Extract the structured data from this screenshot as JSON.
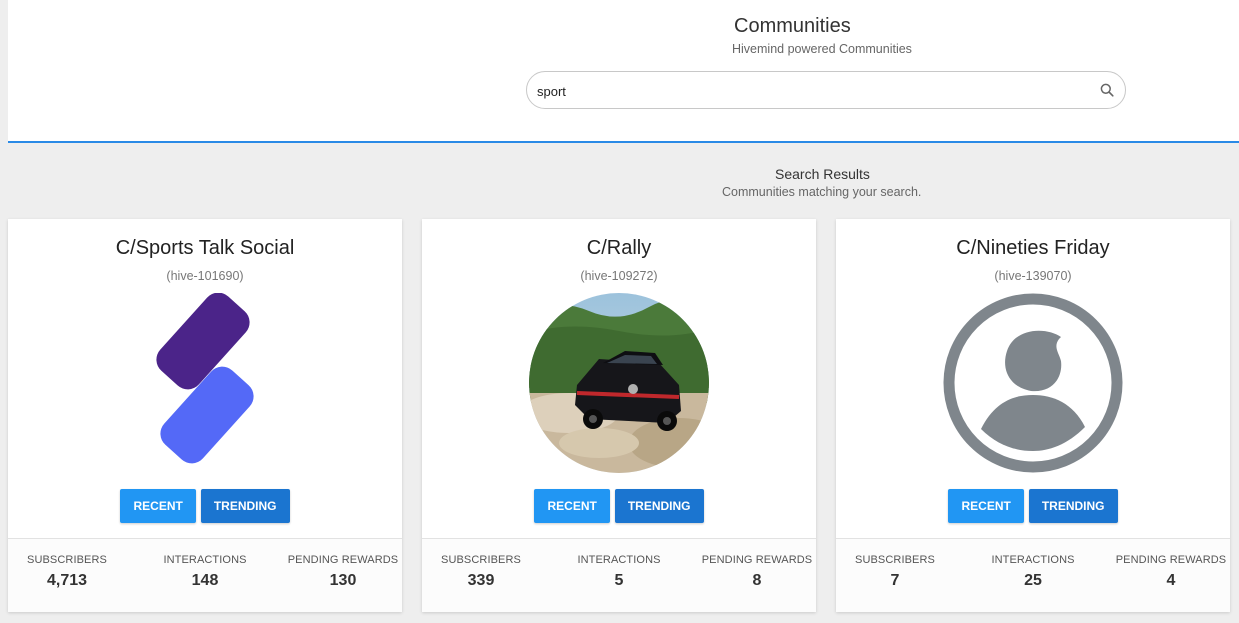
{
  "header": {
    "title": "Communities",
    "subtitle": "Hivemind powered Communities"
  },
  "search": {
    "value": "sport",
    "icon": "search-icon"
  },
  "results": {
    "title": "Search Results",
    "subtitle": "Communities matching your search."
  },
  "colors": {
    "accent": "#2a8ae6",
    "recent_button": "#2196f3",
    "trending_button": "#1b75d0"
  },
  "stat_labels": {
    "subscribers": "SUBSCRIBERS",
    "interactions": "INTERACTIONS",
    "pending_rewards": "PENDING REWARDS"
  },
  "communities": [
    {
      "title": "C/Sports Talk Social",
      "id": "(hive-101690)",
      "avatar": "sports-talk-social-logo",
      "recent_label": "RECENT",
      "trending_label": "TRENDING",
      "subscribers": "4,713",
      "interactions": "148",
      "pending_rewards": "130"
    },
    {
      "title": "C/Rally",
      "id": "(hive-109272)",
      "avatar": "rally-car-photo",
      "recent_label": "RECENT",
      "trending_label": "TRENDING",
      "subscribers": "339",
      "interactions": "5",
      "pending_rewards": "8"
    },
    {
      "title": "C/Nineties Friday",
      "id": "(hive-139070)",
      "avatar": "default-avatar-icon",
      "recent_label": "RECENT",
      "trending_label": "TRENDING",
      "subscribers": "7",
      "interactions": "25",
      "pending_rewards": "4"
    }
  ]
}
